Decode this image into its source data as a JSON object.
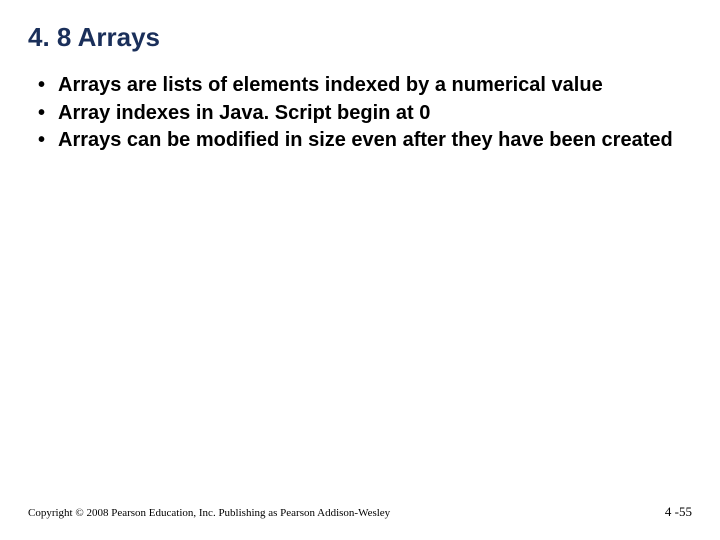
{
  "title": "4. 8 Arrays",
  "bullets": [
    "Arrays are lists of elements indexed by a numerical value",
    "Array indexes in Java. Script begin at 0",
    "Arrays can be modified in size even after they have been created"
  ],
  "footer": {
    "copyright": "Copyright © 2008 Pearson Education, Inc. Publishing as Pearson Addison-Wesley",
    "pagenum": "4 -55"
  }
}
